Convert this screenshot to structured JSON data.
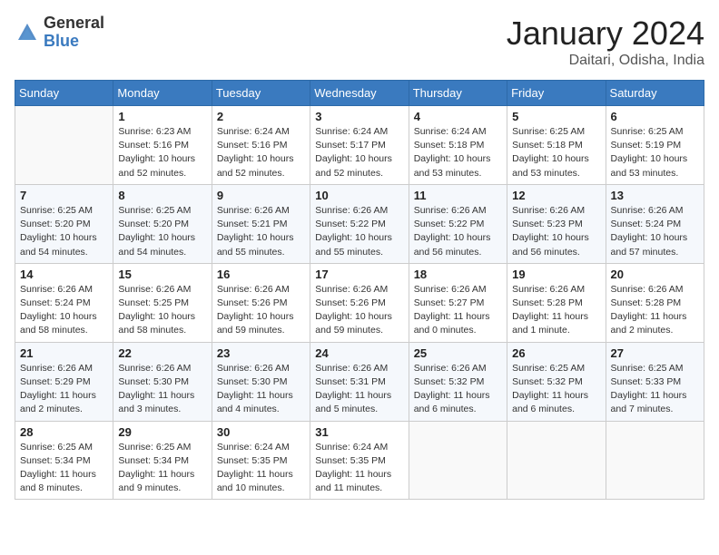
{
  "header": {
    "logo_general": "General",
    "logo_blue": "Blue",
    "month": "January 2024",
    "location": "Daitari, Odisha, India"
  },
  "days_of_week": [
    "Sunday",
    "Monday",
    "Tuesday",
    "Wednesday",
    "Thursday",
    "Friday",
    "Saturday"
  ],
  "weeks": [
    [
      {
        "day": "",
        "info": ""
      },
      {
        "day": "1",
        "info": "Sunrise: 6:23 AM\nSunset: 5:16 PM\nDaylight: 10 hours\nand 52 minutes."
      },
      {
        "day": "2",
        "info": "Sunrise: 6:24 AM\nSunset: 5:16 PM\nDaylight: 10 hours\nand 52 minutes."
      },
      {
        "day": "3",
        "info": "Sunrise: 6:24 AM\nSunset: 5:17 PM\nDaylight: 10 hours\nand 52 minutes."
      },
      {
        "day": "4",
        "info": "Sunrise: 6:24 AM\nSunset: 5:18 PM\nDaylight: 10 hours\nand 53 minutes."
      },
      {
        "day": "5",
        "info": "Sunrise: 6:25 AM\nSunset: 5:18 PM\nDaylight: 10 hours\nand 53 minutes."
      },
      {
        "day": "6",
        "info": "Sunrise: 6:25 AM\nSunset: 5:19 PM\nDaylight: 10 hours\nand 53 minutes."
      }
    ],
    [
      {
        "day": "7",
        "info": "Sunrise: 6:25 AM\nSunset: 5:20 PM\nDaylight: 10 hours\nand 54 minutes."
      },
      {
        "day": "8",
        "info": "Sunrise: 6:25 AM\nSunset: 5:20 PM\nDaylight: 10 hours\nand 54 minutes."
      },
      {
        "day": "9",
        "info": "Sunrise: 6:26 AM\nSunset: 5:21 PM\nDaylight: 10 hours\nand 55 minutes."
      },
      {
        "day": "10",
        "info": "Sunrise: 6:26 AM\nSunset: 5:22 PM\nDaylight: 10 hours\nand 55 minutes."
      },
      {
        "day": "11",
        "info": "Sunrise: 6:26 AM\nSunset: 5:22 PM\nDaylight: 10 hours\nand 56 minutes."
      },
      {
        "day": "12",
        "info": "Sunrise: 6:26 AM\nSunset: 5:23 PM\nDaylight: 10 hours\nand 56 minutes."
      },
      {
        "day": "13",
        "info": "Sunrise: 6:26 AM\nSunset: 5:24 PM\nDaylight: 10 hours\nand 57 minutes."
      }
    ],
    [
      {
        "day": "14",
        "info": "Sunrise: 6:26 AM\nSunset: 5:24 PM\nDaylight: 10 hours\nand 58 minutes."
      },
      {
        "day": "15",
        "info": "Sunrise: 6:26 AM\nSunset: 5:25 PM\nDaylight: 10 hours\nand 58 minutes."
      },
      {
        "day": "16",
        "info": "Sunrise: 6:26 AM\nSunset: 5:26 PM\nDaylight: 10 hours\nand 59 minutes."
      },
      {
        "day": "17",
        "info": "Sunrise: 6:26 AM\nSunset: 5:26 PM\nDaylight: 10 hours\nand 59 minutes."
      },
      {
        "day": "18",
        "info": "Sunrise: 6:26 AM\nSunset: 5:27 PM\nDaylight: 11 hours\nand 0 minutes."
      },
      {
        "day": "19",
        "info": "Sunrise: 6:26 AM\nSunset: 5:28 PM\nDaylight: 11 hours\nand 1 minute."
      },
      {
        "day": "20",
        "info": "Sunrise: 6:26 AM\nSunset: 5:28 PM\nDaylight: 11 hours\nand 2 minutes."
      }
    ],
    [
      {
        "day": "21",
        "info": "Sunrise: 6:26 AM\nSunset: 5:29 PM\nDaylight: 11 hours\nand 2 minutes."
      },
      {
        "day": "22",
        "info": "Sunrise: 6:26 AM\nSunset: 5:30 PM\nDaylight: 11 hours\nand 3 minutes."
      },
      {
        "day": "23",
        "info": "Sunrise: 6:26 AM\nSunset: 5:30 PM\nDaylight: 11 hours\nand 4 minutes."
      },
      {
        "day": "24",
        "info": "Sunrise: 6:26 AM\nSunset: 5:31 PM\nDaylight: 11 hours\nand 5 minutes."
      },
      {
        "day": "25",
        "info": "Sunrise: 6:26 AM\nSunset: 5:32 PM\nDaylight: 11 hours\nand 6 minutes."
      },
      {
        "day": "26",
        "info": "Sunrise: 6:25 AM\nSunset: 5:32 PM\nDaylight: 11 hours\nand 6 minutes."
      },
      {
        "day": "27",
        "info": "Sunrise: 6:25 AM\nSunset: 5:33 PM\nDaylight: 11 hours\nand 7 minutes."
      }
    ],
    [
      {
        "day": "28",
        "info": "Sunrise: 6:25 AM\nSunset: 5:34 PM\nDaylight: 11 hours\nand 8 minutes."
      },
      {
        "day": "29",
        "info": "Sunrise: 6:25 AM\nSunset: 5:34 PM\nDaylight: 11 hours\nand 9 minutes."
      },
      {
        "day": "30",
        "info": "Sunrise: 6:24 AM\nSunset: 5:35 PM\nDaylight: 11 hours\nand 10 minutes."
      },
      {
        "day": "31",
        "info": "Sunrise: 6:24 AM\nSunset: 5:35 PM\nDaylight: 11 hours\nand 11 minutes."
      },
      {
        "day": "",
        "info": ""
      },
      {
        "day": "",
        "info": ""
      },
      {
        "day": "",
        "info": ""
      }
    ]
  ]
}
